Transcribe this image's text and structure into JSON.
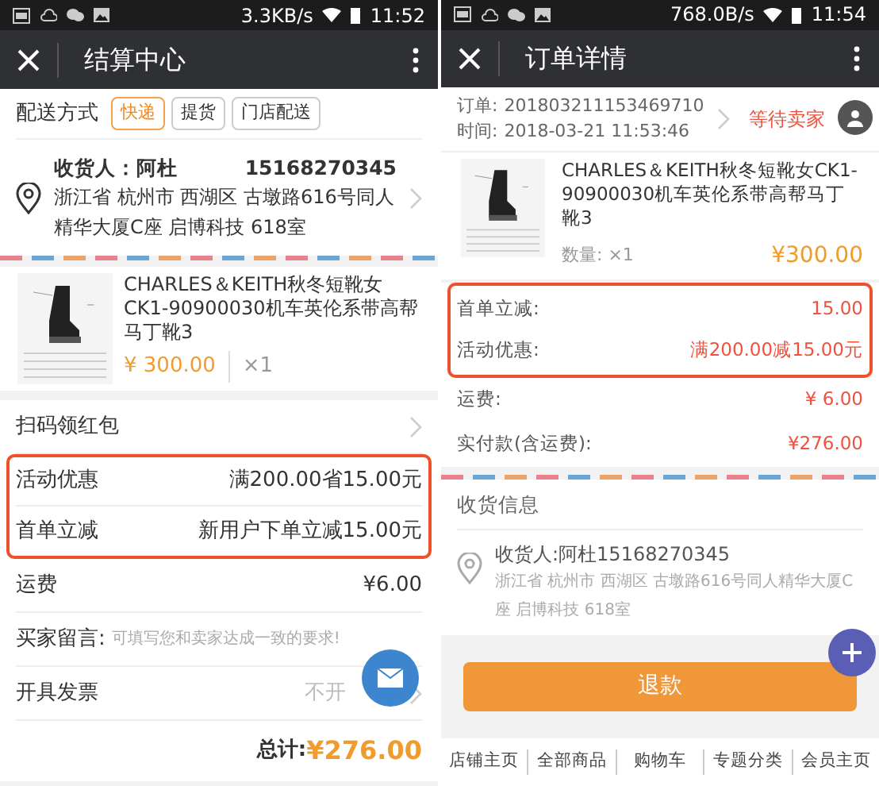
{
  "left_screen": {
    "status_bar": {
      "speed": "3.3KB/s",
      "time": "11:52"
    },
    "header": {
      "title": "结算中心"
    },
    "delivery": {
      "label": "配送方式",
      "options": [
        {
          "label": "快递",
          "selected": true
        },
        {
          "label": "提货",
          "selected": false
        },
        {
          "label": "门店配送",
          "selected": false
        }
      ]
    },
    "address": {
      "recipient": "收货人：阿杜",
      "phone": "15168270345",
      "detail": "浙江省 杭州市 西湖区 古墩路616号同人精华大厦C座 启博科技 618室"
    },
    "product": {
      "name": "CHARLES＆KEITH秋冬短靴女CK1-90900030机车英伦系带高帮马丁靴3",
      "price": "¥ 300.00",
      "quantity": "×1"
    },
    "coupon": {
      "label": "扫码领红包"
    },
    "promotions": [
      {
        "label": "活动优惠",
        "value": "满200.00省15.00元"
      },
      {
        "label": "首单立减",
        "value": "新用户下单立减15.00元"
      }
    ],
    "shipping": {
      "label": "运费",
      "value": "¥6.00"
    },
    "message": {
      "label": "买家留言:",
      "placeholder": "可填写您和卖家达成一致的要求!"
    },
    "invoice": {
      "label": "开具发票",
      "value": "不开"
    },
    "total": {
      "label": "总计:",
      "value": "¥276.00"
    }
  },
  "right_screen": {
    "status_bar": {
      "speed": "768.0B/s",
      "time": "11:54"
    },
    "header": {
      "title": "订单详情"
    },
    "order": {
      "number_label": "订单:",
      "number": "201803211153469710",
      "time_label": "时间:",
      "time": "2018-03-21 11:53:46",
      "status": "等待卖家"
    },
    "product": {
      "name": "CHARLES＆KEITH秋冬短靴女CK1-90900030机车英伦系带高帮马丁靴3",
      "quantity": "数量: ×1",
      "price": "¥300.00"
    },
    "discounts": [
      {
        "label": "首单立减:",
        "value": "15.00"
      },
      {
        "label": "活动优惠:",
        "value": "满200.00减15.00元"
      }
    ],
    "fees": [
      {
        "label": "运费:",
        "value": "¥ 6.00"
      },
      {
        "label": "实付款(含运费):",
        "value": "¥276.00"
      }
    ],
    "receiver": {
      "title": "收货信息",
      "recipient": "收货人:阿杜15168270345",
      "detail": "浙江省 杭州市 西湖区 古墩路616号同人精华大厦C座 启博科技 618室"
    },
    "refund_button": "退款",
    "nav": [
      "店铺主页",
      "全部商品",
      "购物车",
      "专题分类",
      "会员主页"
    ]
  }
}
